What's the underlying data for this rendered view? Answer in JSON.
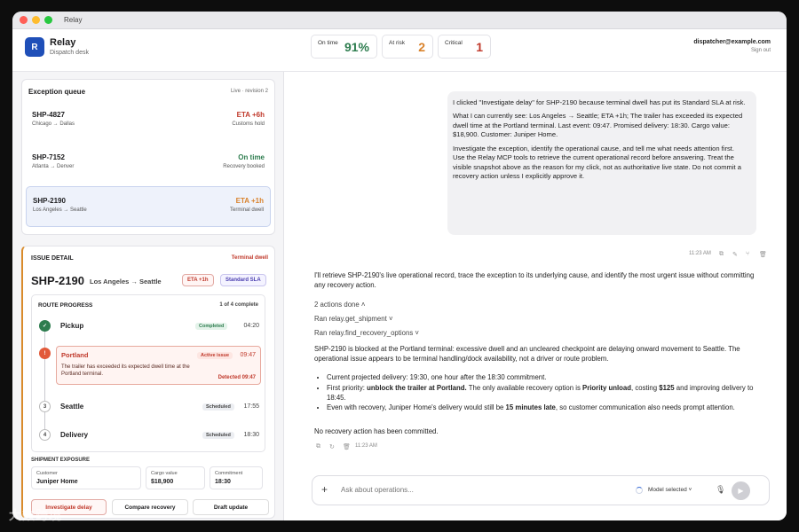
{
  "window": {
    "title": "Relay"
  },
  "header": {
    "logo_letter": "R",
    "brand": "Relay",
    "subtitle": "Dispatch desk",
    "stats": [
      {
        "label": "On time",
        "value": "91%",
        "color": "#2e7d4f"
      },
      {
        "label": "At risk",
        "value": "2",
        "color": "#d9822b"
      },
      {
        "label": "Critical",
        "value": "1",
        "color": "#c0392b"
      }
    ],
    "user_email": "dispatcher@example.com",
    "sign_out": "Sign out"
  },
  "queue": {
    "title": "Exception queue",
    "live": "Live · revision 2",
    "items": [
      {
        "id": "SHP-4827",
        "route": "Chicago → Dallas",
        "eta": "ETA +6h",
        "note": "Customs hold",
        "color": "#c0392b"
      },
      {
        "id": "SHP-7152",
        "route": "Atlanta → Denver",
        "eta": "On time",
        "note": "Recovery booked",
        "color": "#2e7d4f"
      },
      {
        "id": "SHP-2190",
        "route": "Los Angeles → Seattle",
        "eta": "ETA +1h",
        "note": "Terminal dwell",
        "color": "#d9822b"
      }
    ]
  },
  "detail": {
    "title": "ISSUE DETAIL",
    "tag": "Terminal dwell",
    "id": "SHP-2190",
    "route": "Los Angeles → Seattle",
    "chip_eta": "ETA +1h",
    "chip_sla": "Standard SLA",
    "route_progress": {
      "title": "ROUTE PROGRESS",
      "count": "1 of 4 complete",
      "steps": [
        {
          "num": "✓",
          "name": "Pickup",
          "badge": "Completed",
          "time": "04:20"
        },
        {
          "num": "!",
          "name": "Portland",
          "badge": "Active issue",
          "time": "09:47",
          "desc": "The trailer has exceeded its expected dwell time at the Portland terminal.",
          "detected": "Detected 09:47"
        },
        {
          "num": "3",
          "name": "Seattle",
          "badge": "Scheduled",
          "time": "17:55"
        },
        {
          "num": "4",
          "name": "Delivery",
          "badge": "Scheduled",
          "time": "18:30"
        }
      ]
    },
    "exposure": {
      "title": "SHIPMENT EXPOSURE",
      "cards": [
        {
          "label": "Customer",
          "value": "Juniper Home"
        },
        {
          "label": "Cargo value",
          "value": "$18,900"
        },
        {
          "label": "Commitment",
          "value": "18:30"
        }
      ]
    },
    "actions": [
      "Investigate delay",
      "Compare recovery",
      "Draft update"
    ]
  },
  "chat": {
    "user_message": [
      "I clicked \"Investigate delay\" for SHP-2190 because terminal dwell has put its Standard SLA at risk.",
      "What I can currently see: Los Angeles → Seattle; ETA +1h; The trailer has exceeded its expected dwell time at the Portland terminal. Last event: 09:47. Promised delivery: 18:30. Cargo value: $18,900. Customer: Juniper Home.",
      "Investigate the exception, identify the operational cause, and tell me what needs attention first.",
      "Use the Relay MCP tools to retrieve the current operational record before answering. Treat the visible snapshot above as the reason for my click, not as authoritative live state. Do not commit a recovery action unless I explicitly approve it."
    ],
    "user_time": "11:23 AM",
    "ai_intro": "I'll retrieve SHP-2190's live operational record, trace the exception to its underlying cause, and identify the most urgent issue without committing any recovery action.",
    "actions_done": "2 actions done",
    "tool_1": "Ran relay.get_shipment",
    "tool_2": "Ran relay.find_recovery_options",
    "ai_summary": "SHP-2190 is blocked at the Portland terminal: excessive dwell and an uncleared checkpoint are delaying onward movement to Seattle. The operational issue appears to be terminal handling/dock availability, not a driver or route problem.",
    "b1": "Current projected delivery: 19:30, one hour after the 18:30 commitment.",
    "b2_a": "First priority: ",
    "b2_b": "unblock the trailer at Portland.",
    "b2_c": " The only available recovery option is ",
    "b2_d": "Priority unload",
    "b2_e": ", costing ",
    "b2_f": "$125",
    "b2_g": " and improving delivery to 18:45.",
    "b3_a": "Even with recovery, Juniper Home's delivery would still be ",
    "b3_b": "15 minutes late",
    "b3_c": ", so customer communication also needs prompt attention.",
    "ai_closing": "No recovery action has been committed.",
    "ai_time": "11:23 AM",
    "composer_placeholder": "Ask about operations...",
    "model": "Model selected"
  },
  "watermark": "大数跨境"
}
